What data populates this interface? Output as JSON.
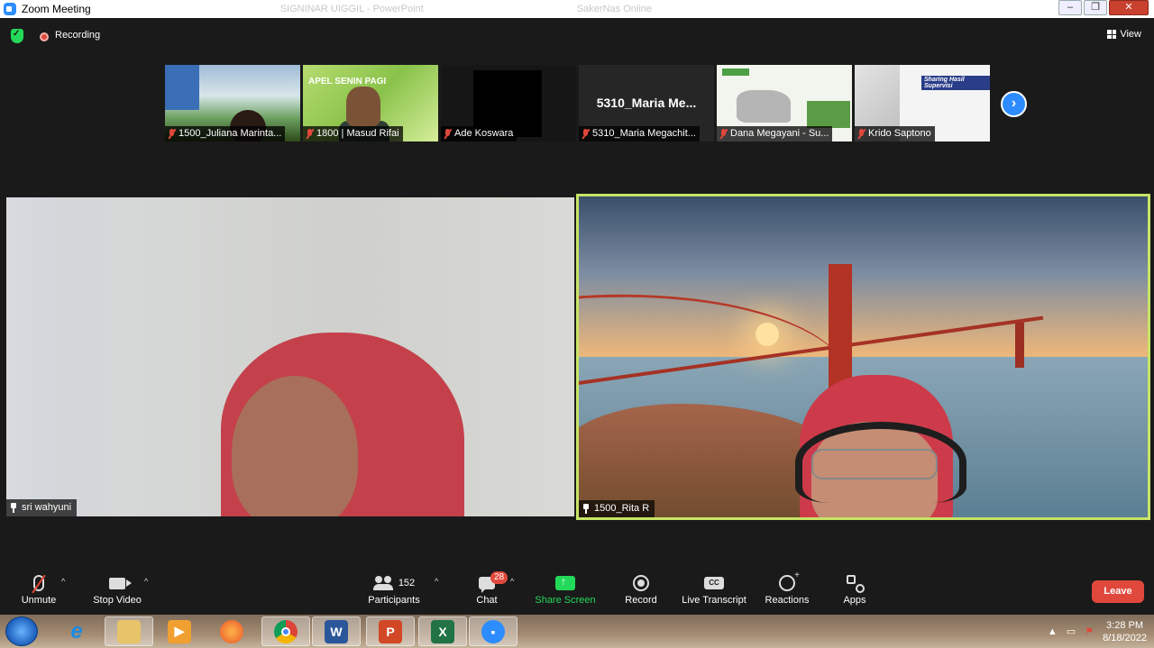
{
  "window": {
    "title": "Zoom Meeting",
    "faded_bg_title_1": "SIGNINAR UIGGIL - PowerPoint",
    "faded_bg_title_2": "SakerNas Online"
  },
  "topbar": {
    "recording_label": "Recording",
    "view_label": "View"
  },
  "thumbnails": [
    {
      "name": "1500_Juliana Marinta...",
      "muted": true
    },
    {
      "name": "1800 | Masud Rifai",
      "muted": true,
      "slide_text": "APEL SENIN PAGI"
    },
    {
      "name": "Ade Koswara",
      "muted": true
    },
    {
      "name": "5310_Maria Megachit...",
      "muted": true,
      "big_name": "5310_Maria Me..."
    },
    {
      "name": "Dana Megayani - Su...",
      "muted": true
    },
    {
      "name": "Krido Saptono",
      "muted": true,
      "slide_text": "Sharing Hasil Supervisi"
    }
  ],
  "main_videos": {
    "left": {
      "name": "sri wahyuni"
    },
    "right": {
      "name": "1500_Rita R",
      "active_speaker": true
    }
  },
  "toolbar": {
    "unmute": "Unmute",
    "stop_video": "Stop Video",
    "participants": "Participants",
    "participants_count": "152",
    "chat": "Chat",
    "chat_badge": "28",
    "share_screen": "Share Screen",
    "record": "Record",
    "live_transcript": "Live Transcript",
    "cc": "CC",
    "reactions": "Reactions",
    "apps": "Apps",
    "leave": "Leave"
  },
  "taskbar": {
    "time": "3:28 PM",
    "date": "8/18/2022",
    "apps": [
      "windows-start",
      "internet-explorer",
      "file-explorer",
      "media-player",
      "firefox",
      "chrome",
      "word",
      "powerpoint",
      "excel",
      "zoom"
    ]
  },
  "colors": {
    "zoom_blue": "#2d8cff",
    "leave_red": "#e0483b",
    "share_green": "#23d959",
    "active_border": "#c7e466"
  }
}
